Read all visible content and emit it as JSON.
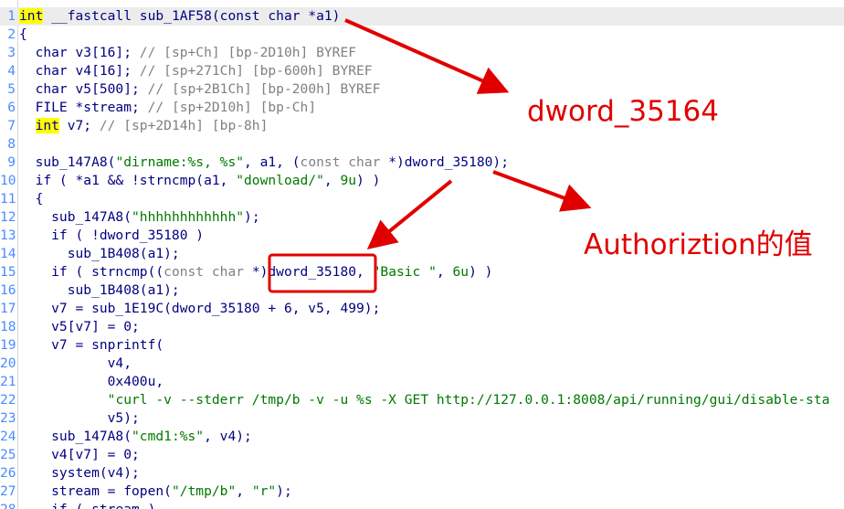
{
  "code": {
    "lines": [
      {
        "n": "1",
        "segs": [
          [
            "int",
            "hl"
          ],
          [
            " __fastcall sub_1AF58(",
            "t"
          ],
          [
            "const char",
            "kw"
          ],
          [
            " *a1)",
            "t"
          ]
        ]
      },
      {
        "n": "2",
        "segs": [
          [
            "{",
            "t"
          ]
        ]
      },
      {
        "n": "3",
        "segs": [
          [
            "  char v3[16]; ",
            "t"
          ],
          [
            "// [sp+Ch] [bp-2D10h] BYREF",
            "cm"
          ]
        ]
      },
      {
        "n": "4",
        "segs": [
          [
            "  char v4[16]; ",
            "t"
          ],
          [
            "// [sp+271Ch] [bp-600h] BYREF",
            "cm"
          ]
        ]
      },
      {
        "n": "5",
        "segs": [
          [
            "  char v5[500]; ",
            "t"
          ],
          [
            "// [sp+2B1Ch] [bp-200h] BYREF",
            "cm"
          ]
        ]
      },
      {
        "n": "6",
        "segs": [
          [
            "  FILE *stream; ",
            "t"
          ],
          [
            "// [sp+2D10h] [bp-Ch]",
            "cm"
          ]
        ]
      },
      {
        "n": "7",
        "segs": [
          [
            "  ",
            "t"
          ],
          [
            "int",
            "hl"
          ],
          [
            " v7; ",
            "t"
          ],
          [
            "// [sp+2D14h] [bp-8h]",
            "cm"
          ]
        ]
      },
      {
        "n": "8",
        "segs": [
          [
            "",
            "t"
          ]
        ]
      },
      {
        "n": "9",
        "segs": [
          [
            "  sub_147A8(",
            "t"
          ],
          [
            "\"dirname:%s, %s\"",
            "str"
          ],
          [
            ", a1, (",
            "t"
          ],
          [
            "const char",
            "cm"
          ],
          [
            " *)dword_35180);",
            "t"
          ]
        ]
      },
      {
        "n": "10",
        "segs": [
          [
            "  if ( *a1 && !strncmp(a1, ",
            "t"
          ],
          [
            "\"download/\"",
            "str"
          ],
          [
            ", ",
            "t"
          ],
          [
            "9u",
            "num"
          ],
          [
            ") )",
            "t"
          ]
        ]
      },
      {
        "n": "11",
        "segs": [
          [
            "  {",
            "t"
          ]
        ]
      },
      {
        "n": "12",
        "segs": [
          [
            "    sub_147A8(",
            "t"
          ],
          [
            "\"hhhhhhhhhhhh\"",
            "str"
          ],
          [
            ");",
            "t"
          ]
        ]
      },
      {
        "n": "13",
        "segs": [
          [
            "    if ( !dword_35180 )",
            "t"
          ]
        ]
      },
      {
        "n": "14",
        "segs": [
          [
            "      sub_1B408(a1);",
            "t"
          ]
        ]
      },
      {
        "n": "15",
        "segs": [
          [
            "    if ( strncmp((",
            "t"
          ],
          [
            "const char",
            "cm"
          ],
          [
            " *)dword_35180, ",
            "t"
          ],
          [
            "\"Basic \"",
            "str"
          ],
          [
            ", ",
            "t"
          ],
          [
            "6u",
            "num"
          ],
          [
            ") )",
            "t"
          ]
        ]
      },
      {
        "n": "16",
        "segs": [
          [
            "      sub_1B408(a1);",
            "t"
          ]
        ]
      },
      {
        "n": "17",
        "segs": [
          [
            "    v7 = sub_1E19C(dword_35180 + 6, v5, 499);",
            "t"
          ]
        ]
      },
      {
        "n": "18",
        "segs": [
          [
            "    v5[v7] = 0;",
            "t"
          ]
        ]
      },
      {
        "n": "19",
        "segs": [
          [
            "    v7 = snprintf(",
            "t"
          ]
        ]
      },
      {
        "n": "20",
        "segs": [
          [
            "           v4,",
            "t"
          ]
        ]
      },
      {
        "n": "21",
        "segs": [
          [
            "           0x400u,",
            "t"
          ]
        ]
      },
      {
        "n": "22",
        "segs": [
          [
            "           ",
            "t"
          ],
          [
            "\"curl -v --stderr /tmp/b -v -u %s -X GET http://127.0.0.1:8008/api/running/gui/disable-sta",
            "str"
          ]
        ]
      },
      {
        "n": "23",
        "segs": [
          [
            "           v5);",
            "t"
          ]
        ]
      },
      {
        "n": "24",
        "segs": [
          [
            "    sub_147A8(",
            "t"
          ],
          [
            "\"cmd1:%s\"",
            "str"
          ],
          [
            ", v4);",
            "t"
          ]
        ]
      },
      {
        "n": "25",
        "segs": [
          [
            "    v4[v7] = 0;",
            "t"
          ]
        ]
      },
      {
        "n": "26",
        "segs": [
          [
            "    system(v4);",
            "t"
          ]
        ]
      },
      {
        "n": "27",
        "segs": [
          [
            "    stream = fopen(",
            "t"
          ],
          [
            "\"/tmp/b\"",
            "str"
          ],
          [
            ", ",
            "t"
          ],
          [
            "\"r\"",
            "str"
          ],
          [
            ");",
            "t"
          ]
        ]
      },
      {
        "n": "28",
        "segs": [
          [
            "    if ( stream )",
            "t"
          ]
        ]
      }
    ]
  },
  "annotations": {
    "note1": "dword_35164",
    "note2": "Authoriztion的值",
    "color": "#e10000"
  }
}
